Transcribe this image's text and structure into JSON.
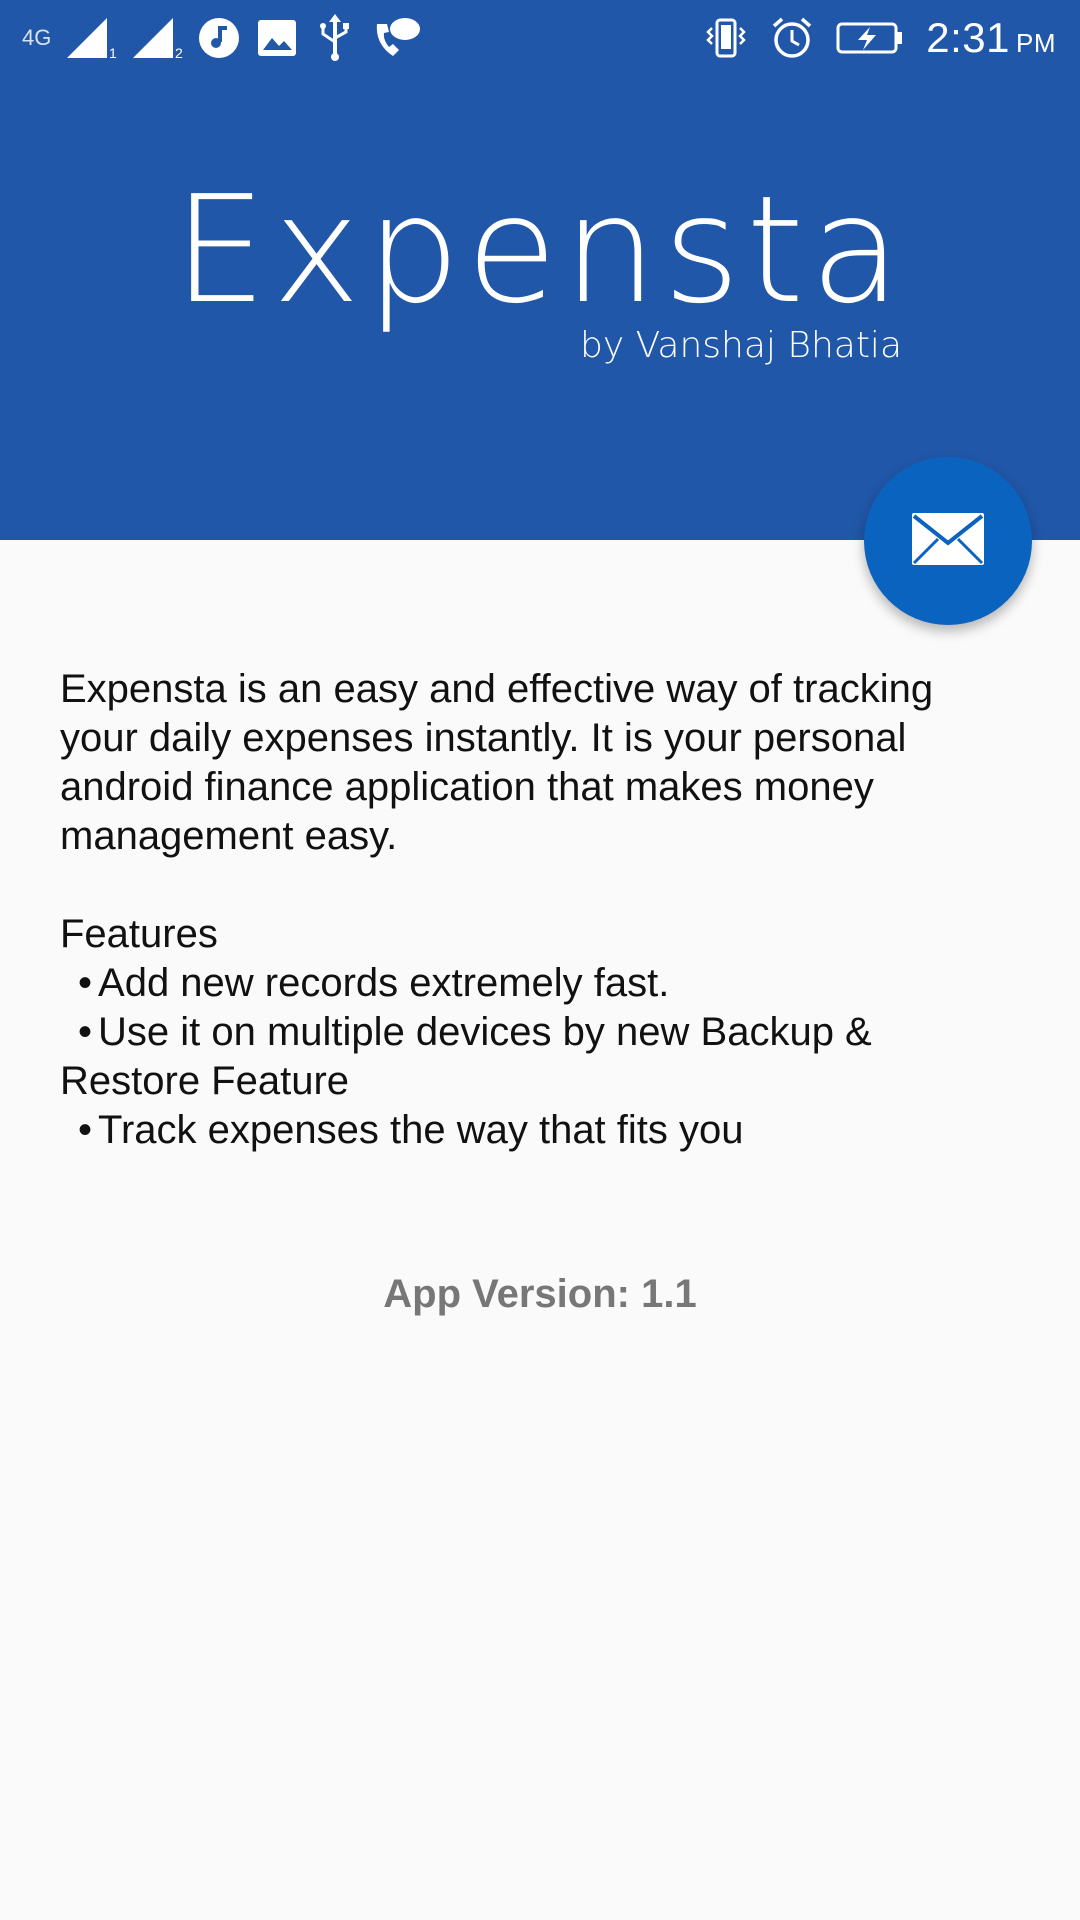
{
  "status_bar": {
    "network_label": "4G",
    "sim1_label": "1",
    "sim2_label": "2",
    "time": "2:31",
    "ampm": "PM",
    "icons": [
      "signal-icon",
      "music-icon",
      "image-icon",
      "usb-icon",
      "chat-call-icon",
      "vibrate-icon",
      "alarm-icon",
      "battery-charging-icon"
    ]
  },
  "header": {
    "app_name": "Expensta",
    "byline": "by Vanshaj Bhatia",
    "background_color": "#2157a8"
  },
  "fab": {
    "icon": "mail-icon",
    "color": "#0b63c0"
  },
  "content": {
    "description": "Expensta is an easy and effective way of tracking your daily expenses instantly. It is your personal android finance application that makes money management easy.",
    "features_title": "Features",
    "features": [
      "Add new records extremely fast.",
      "Use it on multiple devices by new Backup & Restore Feature",
      "Track expenses the way that fits you"
    ],
    "bullet": "•"
  },
  "footer": {
    "version": "App Version: 1.1"
  }
}
